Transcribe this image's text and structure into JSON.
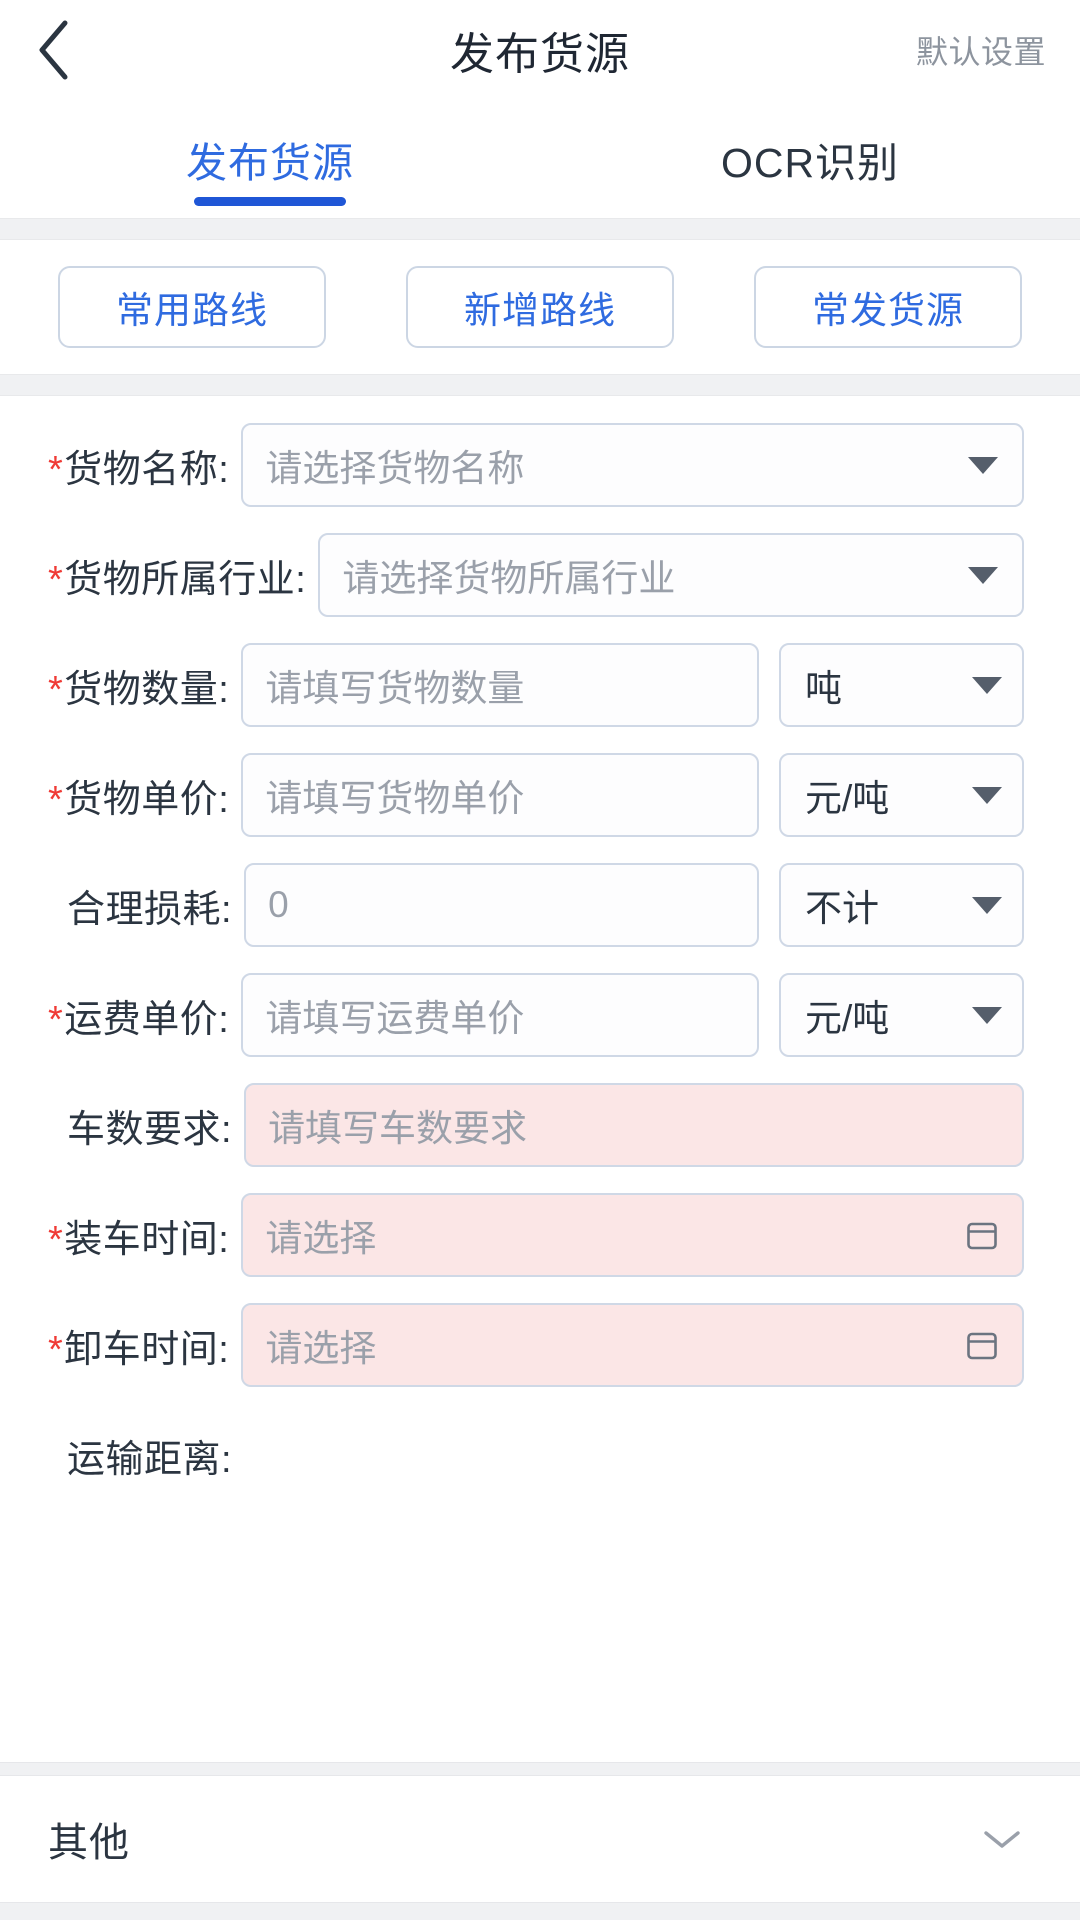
{
  "header": {
    "back_icon": "chevron-left-icon",
    "title": "发布货源",
    "action_label": "默认设置"
  },
  "tabs": [
    {
      "label": "发布货源",
      "active": true
    },
    {
      "label": "OCR识别",
      "active": false
    }
  ],
  "route_buttons": [
    {
      "label": "常用路线"
    },
    {
      "label": "新增路线"
    },
    {
      "label": "常发货源"
    }
  ],
  "form": {
    "cargo_name": {
      "label": "货物名称:",
      "required": true,
      "placeholder": "请选择货物名称",
      "value": "",
      "control": "select",
      "icon": "caret-down-icon"
    },
    "cargo_industry": {
      "label": "货物所属行业:",
      "required": true,
      "placeholder": "请选择货物所属行业",
      "value": "",
      "control": "select",
      "icon": "caret-down-icon"
    },
    "cargo_quantity": {
      "label": "货物数量:",
      "required": true,
      "placeholder": "请填写货物数量",
      "value": "",
      "control": "input",
      "unit": "吨",
      "unit_icon": "caret-down-icon"
    },
    "cargo_unit_price": {
      "label": "货物单价:",
      "required": true,
      "placeholder": "请填写货物单价",
      "value": "",
      "control": "input",
      "unit": "元/吨",
      "unit_icon": "caret-down-icon"
    },
    "reasonable_loss": {
      "label": "合理损耗:",
      "required": false,
      "placeholder": "",
      "value": "0",
      "control": "input",
      "unit": "不计",
      "unit_icon": "caret-down-icon"
    },
    "freight_unit_price": {
      "label": "运费单价:",
      "required": true,
      "placeholder": "请填写运费单价",
      "value": "",
      "control": "input",
      "unit": "元/吨",
      "unit_icon": "caret-down-icon"
    },
    "vehicle_count": {
      "label": "车数要求:",
      "required": false,
      "placeholder": "请填写车数要求",
      "value": "",
      "control": "input",
      "highlight": "pink"
    },
    "loading_time": {
      "label": "装车时间:",
      "required": true,
      "placeholder": "请选择",
      "value": "",
      "control": "date",
      "highlight": "pink",
      "icon": "calendar-icon"
    },
    "unloading_time": {
      "label": "卸车时间:",
      "required": true,
      "placeholder": "请选择",
      "value": "",
      "control": "date",
      "highlight": "pink",
      "icon": "calendar-icon"
    },
    "transport_distance": {
      "label": "运输距离:",
      "required": false,
      "value": ""
    }
  },
  "accordion": {
    "label": "其他",
    "icon": "chevron-down-icon",
    "expanded": false
  },
  "colors": {
    "accent": "#2f6be0",
    "tab_underline": "#1f56d6",
    "required_star": "#ef3b36",
    "pink_field": "#fbe6e6",
    "border": "#cfd8e6",
    "band": "#f0f1f3",
    "placeholder": "#9aa0aa",
    "text": "#2b3541",
    "muted": "#8d949e"
  }
}
